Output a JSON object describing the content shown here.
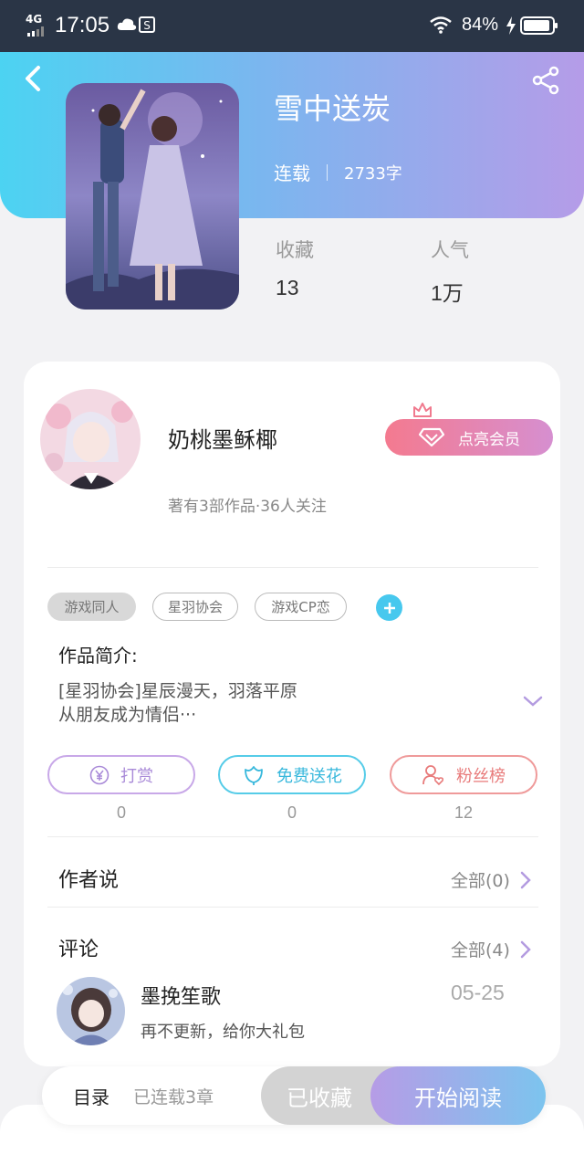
{
  "status_bar": {
    "network": "4G",
    "time": "17:05",
    "battery": "84%"
  },
  "book": {
    "title": "雪中送炭",
    "status": "连载",
    "word_count": "2733字",
    "stats": [
      {
        "label": "收藏",
        "value": "13"
      },
      {
        "label": "人气",
        "value": "1万"
      }
    ]
  },
  "author": {
    "name": "奶桃墨稣椰",
    "meta": "著有3部作品·36人关注",
    "vip_label": "点亮会员"
  },
  "tags": [
    "游戏同人",
    "星羽协会",
    "游戏CP恋"
  ],
  "intro": {
    "label": "作品简介:",
    "line1": "[星羽协会]星辰漫天，羽落平原",
    "line2": "从朋友成为情侣···"
  },
  "actions": [
    {
      "label": "打赏",
      "count": "0"
    },
    {
      "label": "免费送花",
      "count": "0"
    },
    {
      "label": "粉丝榜",
      "count": "12"
    }
  ],
  "author_says": {
    "title": "作者说",
    "more": "全部(0)"
  },
  "comments": {
    "title": "评论",
    "more": "全部(4)",
    "items": [
      {
        "name": "墨挽笙歌",
        "text": "再不更新，给你大礼包",
        "date": "05-25"
      }
    ]
  },
  "bottom": {
    "toc": "目录",
    "chapters": "已连载3章",
    "favorited": "已收藏",
    "start_reading": "开始阅读"
  }
}
